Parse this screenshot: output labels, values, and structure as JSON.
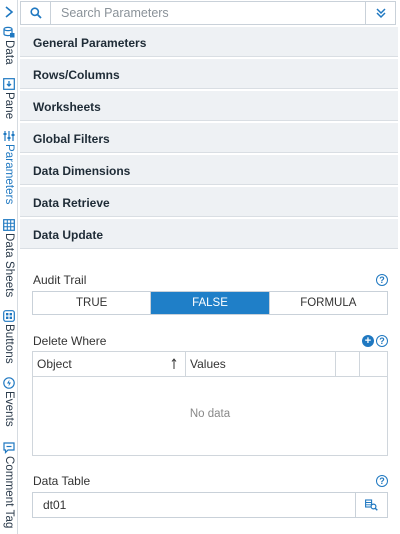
{
  "rail": {
    "items": [
      {
        "label": "Data",
        "icon": "data-icon"
      },
      {
        "label": "Pane",
        "icon": "pane-icon"
      },
      {
        "label": "Parameters",
        "icon": "parameters-icon"
      },
      {
        "label": "Data Sheets",
        "icon": "data-sheets-icon"
      },
      {
        "label": "Buttons",
        "icon": "buttons-icon"
      },
      {
        "label": "Events",
        "icon": "events-icon"
      },
      {
        "label": "Comment Tag",
        "icon": "comment-tag-icon"
      }
    ]
  },
  "search": {
    "placeholder": "Search Parameters",
    "value": ""
  },
  "sections": [
    {
      "label": "General Parameters"
    },
    {
      "label": "Rows/Columns"
    },
    {
      "label": "Worksheets"
    },
    {
      "label": "Global Filters"
    },
    {
      "label": "Data Dimensions"
    },
    {
      "label": "Data Retrieve"
    },
    {
      "label": "Data Update"
    }
  ],
  "audit_trail": {
    "label": "Audit Trail",
    "options": [
      "TRUE",
      "FALSE",
      "FORMULA"
    ],
    "selected": "FALSE"
  },
  "delete_where": {
    "label": "Delete Where",
    "columns": [
      "Object",
      "Values"
    ],
    "empty_text": "No data"
  },
  "data_table": {
    "label": "Data Table",
    "value": "dt01"
  },
  "colors": {
    "accent": "#1f7fc8",
    "section_bg": "#eef1f4"
  }
}
